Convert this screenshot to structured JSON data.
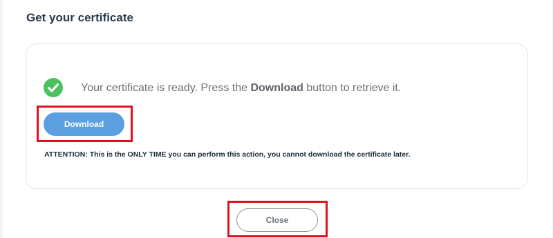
{
  "dialog": {
    "title": "Get your certificate"
  },
  "message": {
    "prefix": "Your certificate is ready. Press the ",
    "emphasis": "Download",
    "suffix": " button to retrieve it.",
    "status_icon": "check-circle-icon",
    "status_color": "#4cc25f"
  },
  "download_button": {
    "label": "Download",
    "color": "#5b9fe0"
  },
  "attention": {
    "text": "ATTENTION: This is the ONLY TIME you can perform this action, you cannot download the certificate later."
  },
  "close_button": {
    "label": "Close"
  },
  "highlight": {
    "color": "#e0101e"
  }
}
